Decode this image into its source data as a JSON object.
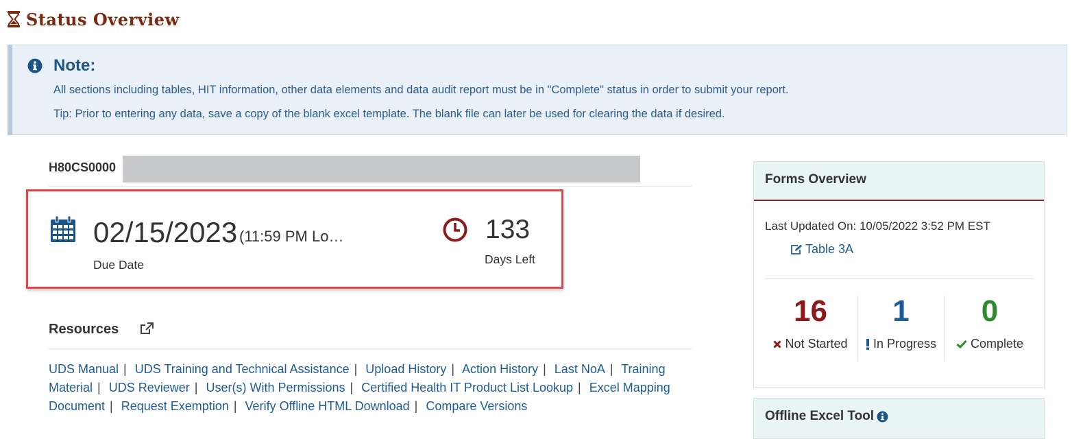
{
  "page": {
    "title": "Status Overview"
  },
  "note": {
    "title": "Note:",
    "line1": "All sections including tables, HIT information, other data elements and data audit report must be in \"Complete\" status in order to submit your report.",
    "line2": "Tip: Prior to entering any data, save a copy of the blank excel template. The blank file can later be used for clearing the data if desired."
  },
  "grant": {
    "id": "H80CS0000"
  },
  "due": {
    "date": "02/15/2023",
    "time": "(11:59 PM Lo…",
    "date_label": "Due Date",
    "days_left": "133",
    "days_label": "Days Left"
  },
  "resources": {
    "title": "Resources",
    "links": [
      "UDS Manual",
      "UDS Training and Technical Assistance",
      "Upload History",
      "Action History",
      "Last NoA",
      "Training Material",
      "UDS Reviewer",
      "User(s) With Permissions",
      "Certified Health IT Product List Lookup",
      "Excel Mapping Document",
      "Request Exemption",
      "Verify Offline HTML Download",
      "Compare Versions"
    ]
  },
  "forms": {
    "title": "Forms Overview",
    "updated": "Last Updated On: 10/05/2022 3:52 PM EST",
    "link": "Table 3A",
    "stats": [
      {
        "value": "16",
        "label": "Not Started",
        "color": "#8b1a1a",
        "icon": "x-icon"
      },
      {
        "value": "1",
        "label": "In Progress",
        "color": "#1d5c96",
        "icon": "exclamation-icon"
      },
      {
        "value": "0",
        "label": "Complete",
        "color": "#2e8b2e",
        "icon": "check-icon"
      }
    ]
  },
  "offline": {
    "title": "Offline Excel Tool"
  },
  "colors": {
    "brand": "#7a2a0e",
    "link": "#1d5c96",
    "highlight": "#e0474c",
    "panel_head": "#e9f5f4"
  }
}
